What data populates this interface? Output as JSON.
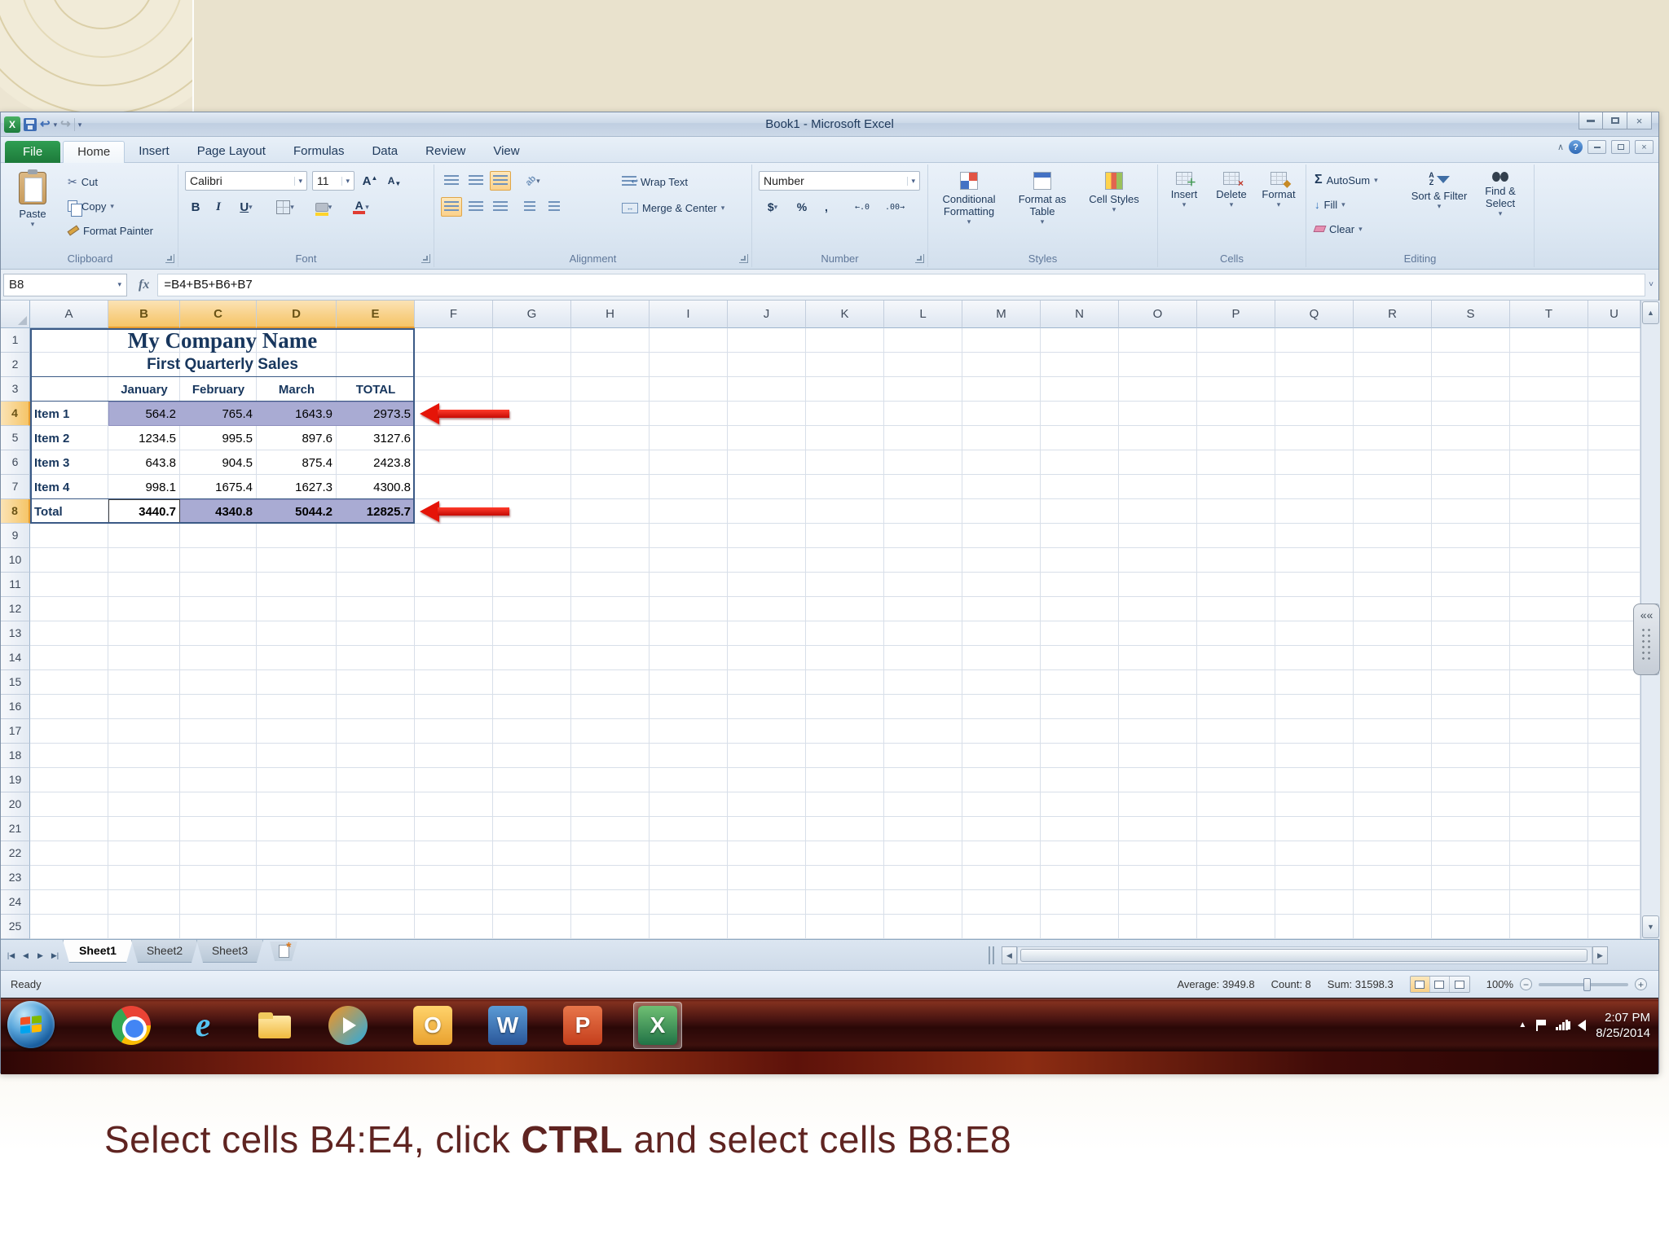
{
  "titlebar": {
    "title": "Book1 - Microsoft Excel"
  },
  "ribbon_tabs": [
    {
      "label": "File",
      "active": false,
      "file": true
    },
    {
      "label": "Home",
      "active": true,
      "file": false
    },
    {
      "label": "Insert",
      "active": false,
      "file": false
    },
    {
      "label": "Page Layout",
      "active": false,
      "file": false
    },
    {
      "label": "Formulas",
      "active": false,
      "file": false
    },
    {
      "label": "Data",
      "active": false,
      "file": false
    },
    {
      "label": "Review",
      "active": false,
      "file": false
    },
    {
      "label": "View",
      "active": false,
      "file": false
    }
  ],
  "ribbon": {
    "clipboard": {
      "group": "Clipboard",
      "paste": "Paste",
      "cut": "Cut",
      "copy": "Copy",
      "format_painter": "Format Painter"
    },
    "font": {
      "group": "Font",
      "name": "Calibri",
      "size": "11",
      "bold": "B",
      "italic": "I",
      "underline": "U"
    },
    "alignment": {
      "group": "Alignment",
      "wrap": "Wrap Text",
      "merge": "Merge & Center"
    },
    "number": {
      "group": "Number",
      "format": "Number",
      "currency": "$",
      "percent": "%",
      "comma": ","
    },
    "styles": {
      "group": "Styles",
      "conditional": "Conditional Formatting",
      "format_table": "Format as Table",
      "cell_styles": "Cell Styles"
    },
    "cells": {
      "group": "Cells",
      "insert": "Insert",
      "delete": "Delete",
      "format": "Format"
    },
    "editing": {
      "group": "Editing",
      "autosum": "AutoSum",
      "fill": "Fill",
      "clear": "Clear",
      "sort": "Sort & Filter",
      "find": "Find & Select"
    }
  },
  "formula_bar": {
    "name_box": "B8",
    "fx": "fx",
    "formula": "=B4+B5+B6+B7"
  },
  "sheet": {
    "columns": [
      "A",
      "B",
      "C",
      "D",
      "E",
      "F",
      "G",
      "H",
      "I",
      "J",
      "K",
      "L",
      "M",
      "N",
      "O",
      "P",
      "Q",
      "R",
      "S",
      "T",
      "U"
    ],
    "selected_columns": [
      "B",
      "C",
      "D",
      "E"
    ],
    "selected_rows": [
      4,
      8
    ],
    "active_cell": "B8",
    "title": "My Company Name",
    "subtitle": "First Quarterly Sales",
    "month_headers": [
      "January",
      "February",
      "March",
      "TOTAL"
    ],
    "rows": [
      {
        "label": "Item 1",
        "values": [
          "564.2",
          "765.4",
          "1643.9",
          "2973.5"
        ],
        "selected": true,
        "bold": false
      },
      {
        "label": "Item 2",
        "values": [
          "1234.5",
          "995.5",
          "897.6",
          "3127.6"
        ],
        "selected": false,
        "bold": false
      },
      {
        "label": "Item 3",
        "values": [
          "643.8",
          "904.5",
          "875.4",
          "2423.8"
        ],
        "selected": false,
        "bold": false
      },
      {
        "label": "Item 4",
        "values": [
          "998.1",
          "1675.4",
          "1627.3",
          "4300.8"
        ],
        "selected": false,
        "bold": false
      },
      {
        "label": "Total",
        "values": [
          "3440.7",
          "4340.8",
          "5044.2",
          "12825.7"
        ],
        "selected": true,
        "bold": true
      }
    ]
  },
  "sheet_tabs": {
    "tabs": [
      {
        "label": "Sheet1",
        "active": true
      },
      {
        "label": "Sheet2",
        "active": false
      },
      {
        "label": "Sheet3",
        "active": false
      }
    ]
  },
  "status_bar": {
    "mode": "Ready",
    "average": "Average: 3949.8",
    "count": "Count: 8",
    "sum": "Sum: 31598.3",
    "zoom": "100%"
  },
  "taskbar": {
    "icons": [
      {
        "name": "start-button",
        "letter": ""
      },
      {
        "name": "chrome",
        "letter": ""
      },
      {
        "name": "internet-explorer",
        "letter": "e"
      },
      {
        "name": "windows-explorer",
        "letter": ""
      },
      {
        "name": "media-player",
        "letter": ""
      },
      {
        "name": "outlook",
        "letter": "O"
      },
      {
        "name": "word",
        "letter": "W"
      },
      {
        "name": "powerpoint",
        "letter": "P"
      },
      {
        "name": "excel",
        "letter": "X",
        "active": true
      }
    ],
    "clock": {
      "time": "2:07 PM",
      "date": "8/25/2014"
    }
  },
  "caption": {
    "pre": "Select cells B4:E4, click ",
    "bold": "CTRL",
    "post": " and select cells B8:E8"
  }
}
